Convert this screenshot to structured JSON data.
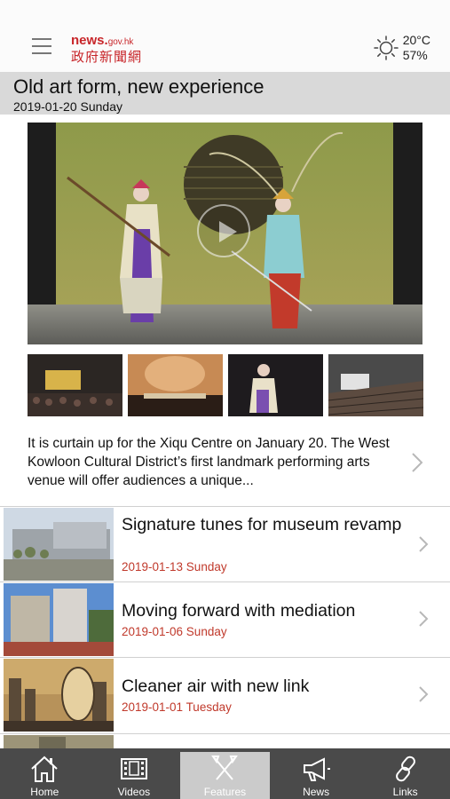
{
  "header": {
    "logo_en": "news.",
    "logo_domain": "gov.hk",
    "logo_cn": "政府新聞網",
    "temperature": "20°C",
    "humidity": "57%"
  },
  "feature": {
    "title": "Old art form, new experience",
    "date": "2019-01-20 Sunday",
    "summary": "It is curtain up for the Xiqu Centre on January 20. The West Kowloon Cultural District’s first landmark performing arts venue will offer audiences a unique..."
  },
  "news": [
    {
      "title": "Signature tunes for museum revamp",
      "date": "2019-01-13 Sunday"
    },
    {
      "title": "Moving forward with mediation",
      "date": "2019-01-06 Sunday"
    },
    {
      "title": "Cleaner air with new link",
      "date": "2019-01-01 Tuesday"
    }
  ],
  "tabs": [
    {
      "label": "Home",
      "icon": "home-icon"
    },
    {
      "label": "Videos",
      "icon": "film-icon"
    },
    {
      "label": "Features",
      "icon": "features-icon",
      "active": true
    },
    {
      "label": "News",
      "icon": "megaphone-icon"
    },
    {
      "label": "Links",
      "icon": "link-icon"
    }
  ],
  "colors": {
    "brand_red": "#c8262a",
    "date_red": "#c0392b",
    "tabbar": "#4a4a4a",
    "tab_active": "#cbcbcb",
    "title_bar": "#d9d9d9"
  }
}
